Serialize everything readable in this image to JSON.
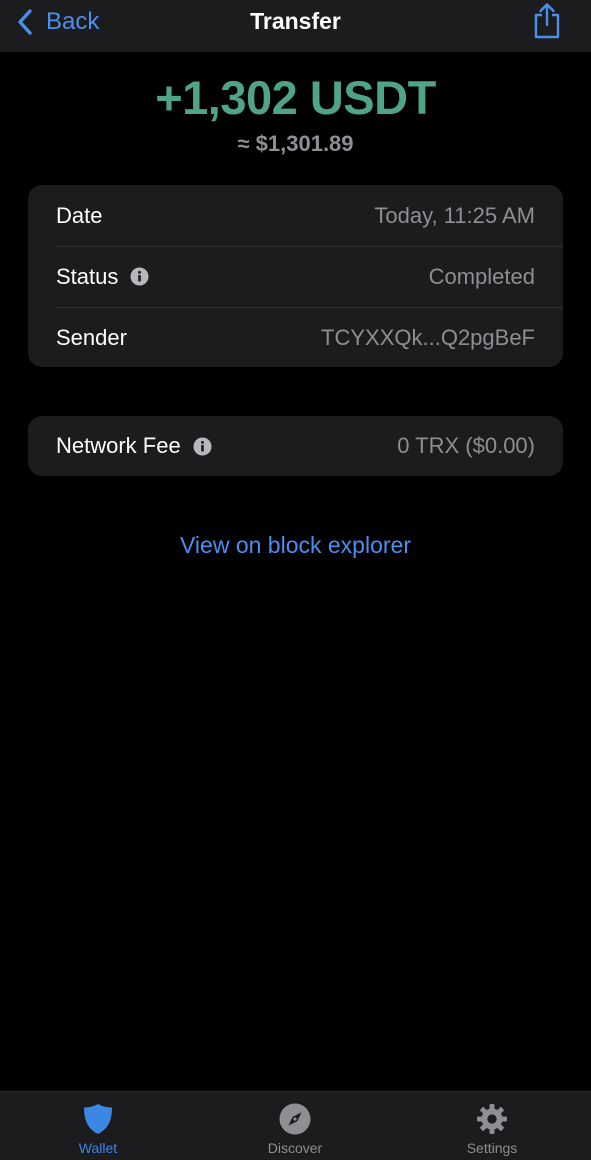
{
  "nav": {
    "back_label": "Back",
    "title": "Transfer",
    "share_icon": "share-icon"
  },
  "amount": {
    "crypto": "+1,302 USDT",
    "fiat": "≈ $1,301.89"
  },
  "details": [
    {
      "label": "Date",
      "value": "Today, 11:25 AM",
      "info": false
    },
    {
      "label": "Status",
      "value": "Completed",
      "info": true
    },
    {
      "label": "Sender",
      "value": "TCYXXQk...Q2pgBeF",
      "info": false
    }
  ],
  "fee": {
    "label": "Network Fee",
    "value": "0 TRX ($0.00)",
    "info": true
  },
  "explorer_link": "View on block explorer",
  "tabs": [
    {
      "label": "Wallet",
      "icon": "shield-icon",
      "active": true
    },
    {
      "label": "Discover",
      "icon": "compass-icon",
      "active": false
    },
    {
      "label": "Settings",
      "icon": "gear-icon",
      "active": false
    }
  ],
  "colors": {
    "accent": "#4a8ff0",
    "amount_green": "#4fa487",
    "secondary_text": "#8e8e93",
    "card_bg": "#1c1c1e",
    "background": "#000000"
  }
}
